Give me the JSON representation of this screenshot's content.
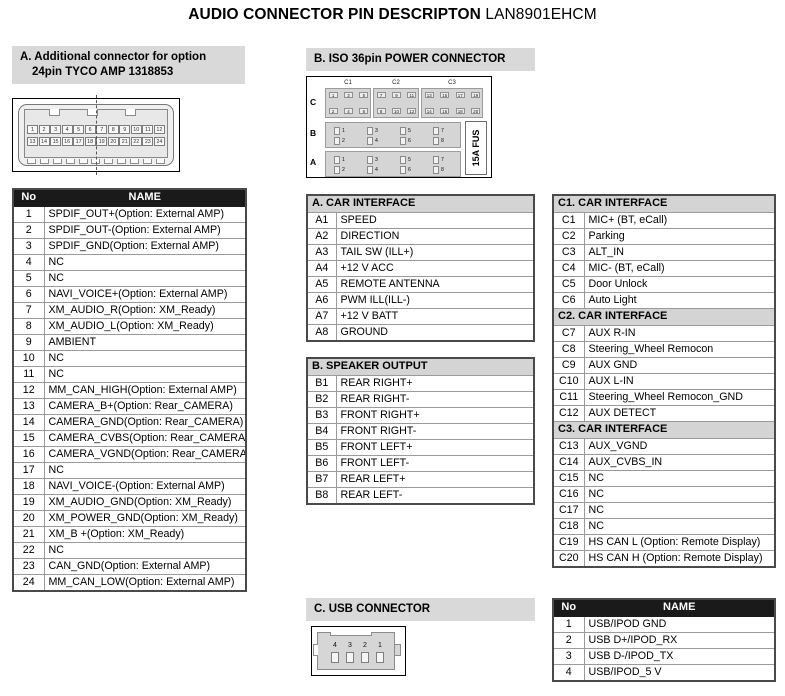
{
  "title": {
    "bold": "AUDIO CONNECTOR PIN DESCRIPTON",
    "model": "LAN8901EHCM"
  },
  "section_a": {
    "header_line1": "A. Additional connector for option",
    "header_line2": "24pin TYCO AMP 1318853",
    "connector": {
      "top_pins": [
        "1",
        "2",
        "3",
        "4",
        "5",
        "6",
        "7",
        "8",
        "9",
        "10",
        "11",
        "12"
      ],
      "bottom_pins": [
        "13",
        "14",
        "15",
        "16",
        "17",
        "18",
        "19",
        "20",
        "21",
        "22",
        "23",
        "24"
      ]
    },
    "table": {
      "col_no": "No",
      "col_name": "NAME",
      "rows": [
        {
          "no": "1",
          "name": "SPDIF_OUT+(Option: External AMP)"
        },
        {
          "no": "2",
          "name": "SPDIF_OUT-(Option: External AMP)"
        },
        {
          "no": "3",
          "name": "SPDIF_GND(Option: External AMP)"
        },
        {
          "no": "4",
          "name": "NC"
        },
        {
          "no": "5",
          "name": "NC"
        },
        {
          "no": "6",
          "name": "NAVI_VOICE+(Option: External AMP)"
        },
        {
          "no": "7",
          "name": "XM_AUDIO_R(Option: XM_Ready)"
        },
        {
          "no": "8",
          "name": "XM_AUDIO_L(Option: XM_Ready)"
        },
        {
          "no": "9",
          "name": "AMBIENT"
        },
        {
          "no": "10",
          "name": "NC"
        },
        {
          "no": "11",
          "name": "NC"
        },
        {
          "no": "12",
          "name": "MM_CAN_HIGH(Option: External AMP)"
        },
        {
          "no": "13",
          "name": "CAMERA_B+(Option: Rear_CAMERA)"
        },
        {
          "no": "14",
          "name": "CAMERA_GND(Option: Rear_CAMERA)"
        },
        {
          "no": "15",
          "name": "CAMERA_CVBS(Option: Rear_CAMERA)"
        },
        {
          "no": "16",
          "name": "CAMERA_VGND(Option: Rear_CAMERA)"
        },
        {
          "no": "17",
          "name": "NC"
        },
        {
          "no": "18",
          "name": "NAVI_VOICE-(Option: External AMP)"
        },
        {
          "no": "19",
          "name": "XM_AUDIO_GND(Option: XM_Ready)"
        },
        {
          "no": "20",
          "name": "XM_POWER_GND(Option: XM_Ready)"
        },
        {
          "no": "21",
          "name": "XM_B +(Option: XM_Ready)"
        },
        {
          "no": "22",
          "name": "NC"
        },
        {
          "no": "23",
          "name": "CAN_GND(Option: External AMP)"
        },
        {
          "no": "24",
          "name": "MM_CAN_LOW(Option: External AMP)"
        }
      ]
    }
  },
  "section_b": {
    "header": "B. ISO 36pin POWER CONNECTOR",
    "diagram": {
      "column_labels": [
        "C1",
        "C2",
        "C3"
      ],
      "row_labels": [
        "C",
        "B",
        "A"
      ],
      "c1_pins": [
        "1",
        "2",
        "3",
        "4",
        "5",
        "6"
      ],
      "c2_pins": [
        "7",
        "8",
        "9",
        "10",
        "11",
        "12"
      ],
      "c3_pins": [
        "13",
        "14",
        "15",
        "16",
        "17",
        "18",
        "19",
        "20"
      ],
      "b_pins": [
        "1",
        "2",
        "3",
        "4",
        "5",
        "6",
        "7",
        "8"
      ],
      "a_pins": [
        "1",
        "2",
        "3",
        "4",
        "5",
        "6",
        "7",
        "8"
      ],
      "fuse_label": "15A FUS"
    }
  },
  "table_a": {
    "header": "A. CAR INTERFACE",
    "rows": [
      {
        "no": "A1",
        "name": "SPEED"
      },
      {
        "no": "A2",
        "name": "DIRECTION"
      },
      {
        "no": "A3",
        "name": "TAIL SW (ILL+)"
      },
      {
        "no": "A4",
        "name": "+12 V ACC"
      },
      {
        "no": "A5",
        "name": "REMOTE ANTENNA"
      },
      {
        "no": "A6",
        "name": "PWM ILL(ILL-)"
      },
      {
        "no": "A7",
        "name": "+12 V BATT"
      },
      {
        "no": "A8",
        "name": "GROUND"
      }
    ]
  },
  "table_b": {
    "header": "B. SPEAKER OUTPUT",
    "rows": [
      {
        "no": "B1",
        "name": "REAR RIGHT+"
      },
      {
        "no": "B2",
        "name": "REAR RIGHT-"
      },
      {
        "no": "B3",
        "name": "FRONT RIGHT+"
      },
      {
        "no": "B4",
        "name": "FRONT RIGHT-"
      },
      {
        "no": "B5",
        "name": "FRONT LEFT+"
      },
      {
        "no": "B6",
        "name": "FRONT LEFT-"
      },
      {
        "no": "B7",
        "name": "REAR LEFT+"
      },
      {
        "no": "B8",
        "name": "REAR LEFT-"
      }
    ]
  },
  "table_c": {
    "groups": [
      {
        "header": "C1. CAR INTERFACE",
        "rows": [
          {
            "no": "C1",
            "name": "MIC+ (BT, eCall)"
          },
          {
            "no": "C2",
            "name": "Parking"
          },
          {
            "no": "C3",
            "name": "ALT_IN"
          },
          {
            "no": "C4",
            "name": "MIC- (BT, eCall)"
          },
          {
            "no": "C5",
            "name": "Door Unlock"
          },
          {
            "no": "C6",
            "name": "Auto Light"
          }
        ]
      },
      {
        "header": "C2. CAR INTERFACE",
        "rows": [
          {
            "no": "C7",
            "name": "AUX R-IN"
          },
          {
            "no": "C8",
            "name": "Steering_Wheel Remocon"
          },
          {
            "no": "C9",
            "name": "AUX GND"
          },
          {
            "no": "C10",
            "name": "AUX L-IN"
          },
          {
            "no": "C11",
            "name": "Steering_Wheel Remocon_GND"
          },
          {
            "no": "C12",
            "name": "AUX DETECT"
          }
        ]
      },
      {
        "header": "C3. CAR INTERFACE",
        "rows": [
          {
            "no": "C13",
            "name": "AUX_VGND"
          },
          {
            "no": "C14",
            "name": "AUX_CVBS_IN"
          },
          {
            "no": "C15",
            "name": "NC"
          },
          {
            "no": "C16",
            "name": "NC"
          },
          {
            "no": "C17",
            "name": "NC"
          },
          {
            "no": "C18",
            "name": "NC"
          },
          {
            "no": "C19",
            "name": "HS CAN L (Option: Remote Display)"
          },
          {
            "no": "C20",
            "name": "HS CAN H (Option: Remote Display)"
          }
        ]
      }
    ]
  },
  "section_c_usb": {
    "header": "C. USB CONNECTOR",
    "diagram": {
      "pins": [
        "4",
        "3",
        "2",
        "1"
      ]
    },
    "table": {
      "col_no": "No",
      "col_name": "NAME",
      "rows": [
        {
          "no": "1",
          "name": "USB/IPOD GND"
        },
        {
          "no": "2",
          "name": "USB D+/IPOD_RX"
        },
        {
          "no": "3",
          "name": "USB D-/IPOD_TX"
        },
        {
          "no": "4",
          "name": "USB/IPOD_5 V"
        }
      ]
    }
  },
  "colors": {
    "section_header_bg": "#d9d9d9",
    "table_header_bg": "#1a1a1a",
    "group_header_bg": "#d4d4d4",
    "border": "#9a9a9a"
  }
}
